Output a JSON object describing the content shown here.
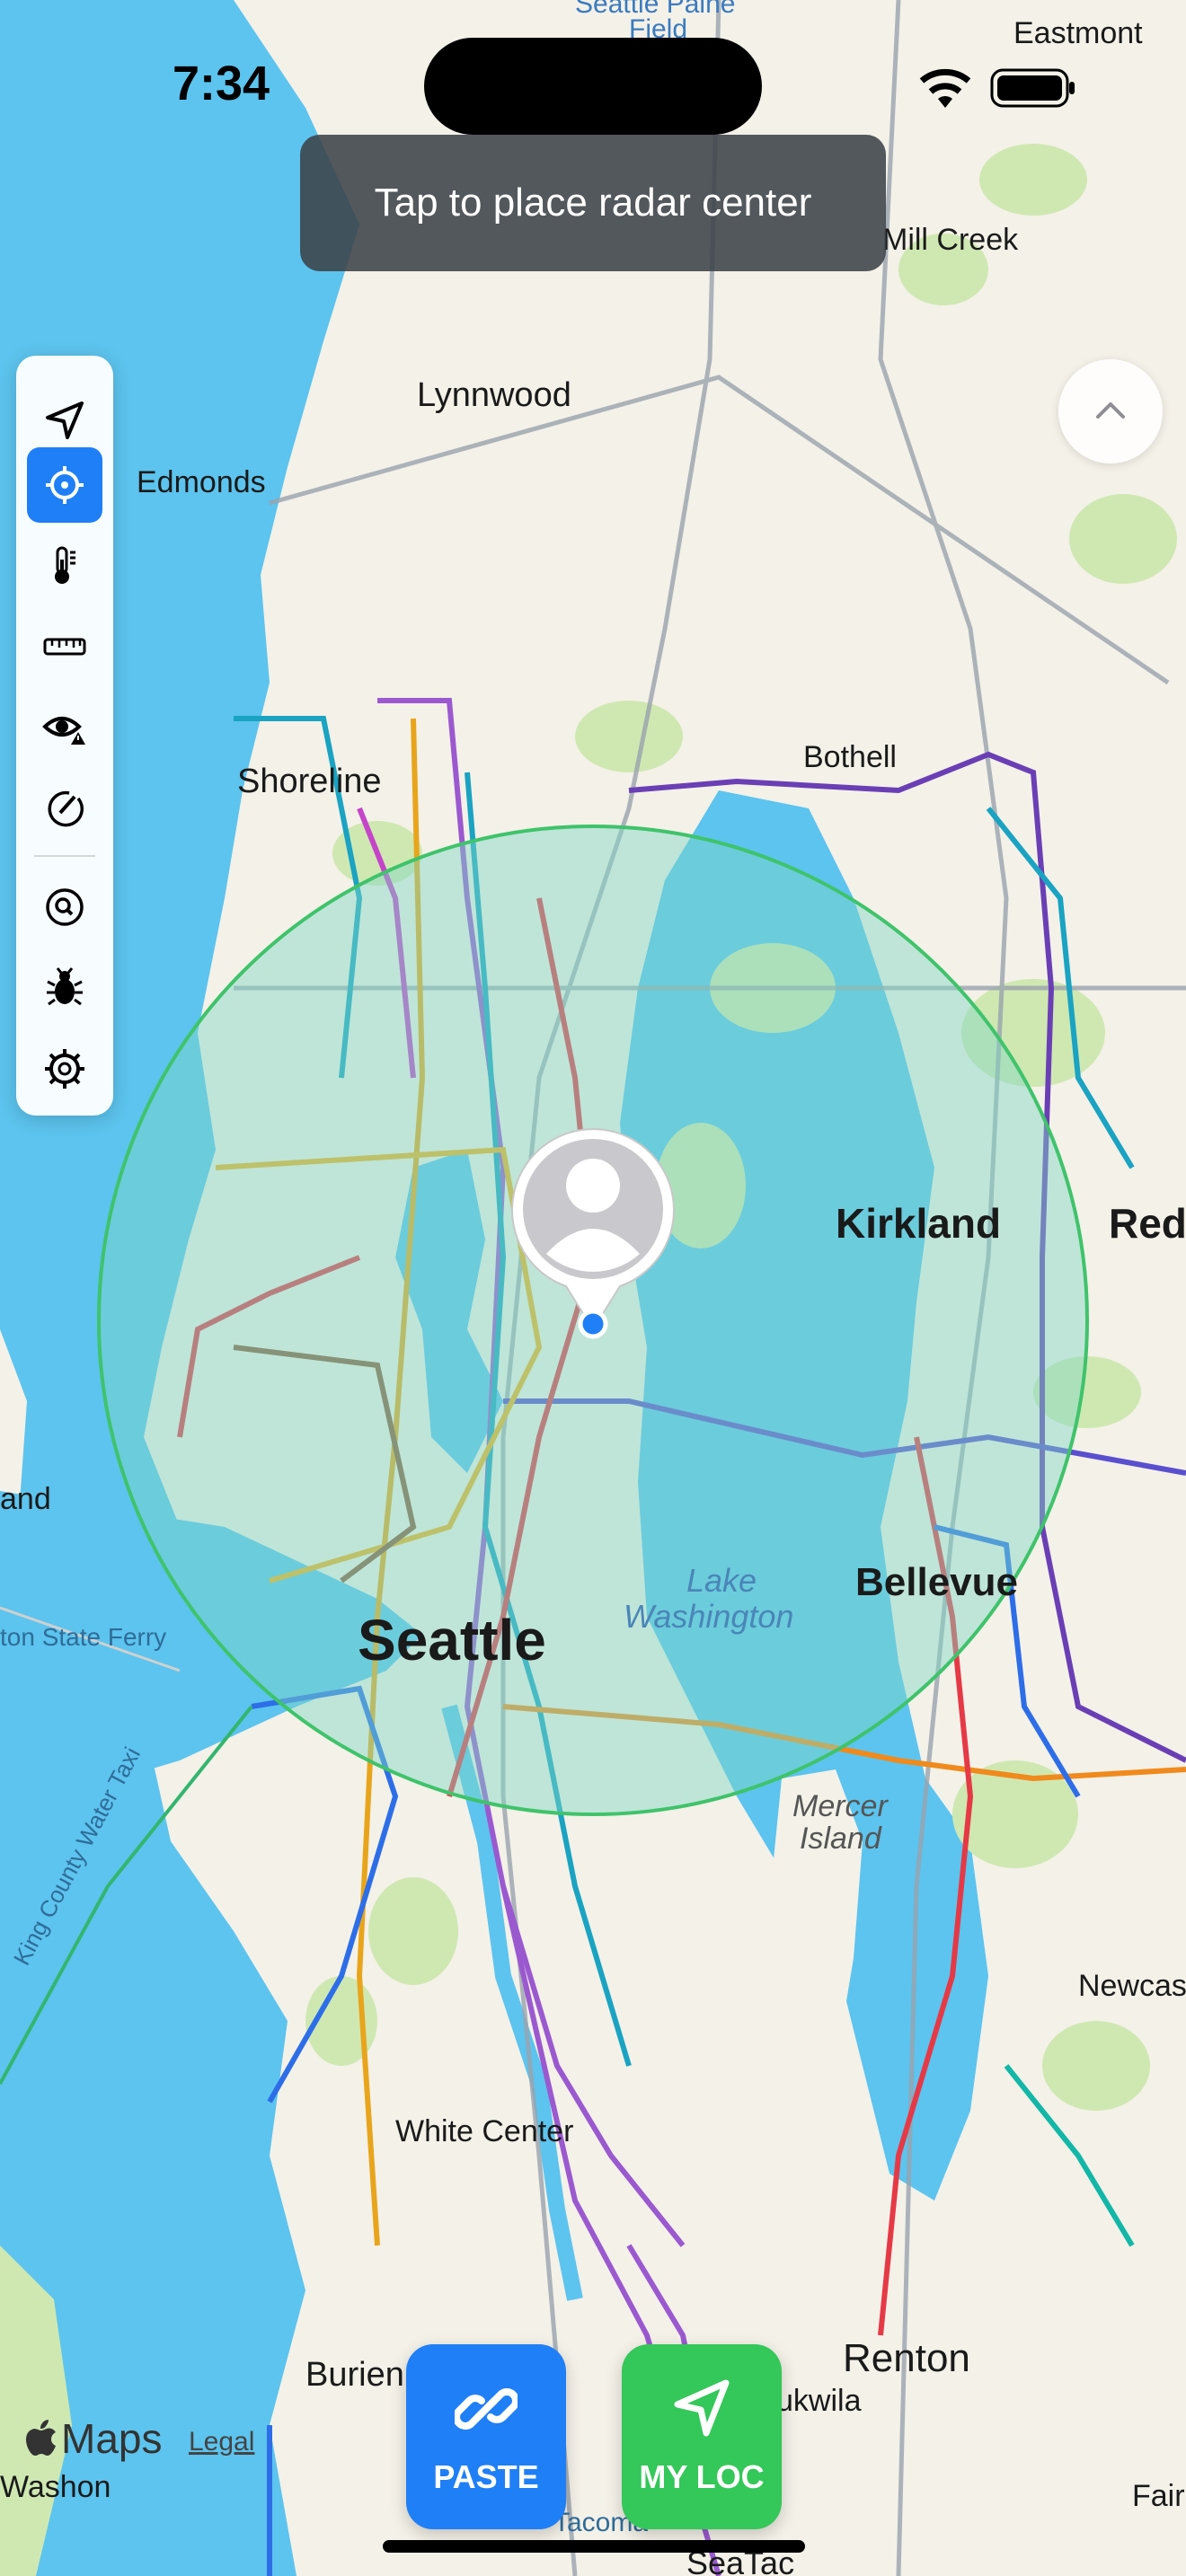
{
  "status_bar": {
    "time": "7:34"
  },
  "toast": {
    "text": "Tap to place radar center"
  },
  "toolbar": {
    "items": [
      {
        "icon": "navigation-arrow-icon",
        "active": false
      },
      {
        "icon": "crosshair-icon",
        "active": true
      },
      {
        "icon": "thermometer-icon",
        "active": false
      },
      {
        "icon": "ruler-icon",
        "active": false
      },
      {
        "icon": "eye-warning-icon",
        "active": false
      },
      {
        "icon": "compass-icon",
        "active": false
      },
      {
        "icon": "search-zoom-icon",
        "active": false
      },
      {
        "icon": "bug-icon",
        "active": false
      },
      {
        "icon": "gear-icon",
        "active": false
      }
    ]
  },
  "map": {
    "labels": {
      "seattle_paine": "Seattle Paine",
      "field": "Field",
      "eastmont": "Eastmont",
      "mill_creek": "Mill Creek",
      "lynnwood": "Lynnwood",
      "edmonds": "Edmonds",
      "shoreline": "Shoreline",
      "bothell": "Bothell",
      "kirkland": "Kirkland",
      "red": "Red",
      "and": "and",
      "lake": "Lake",
      "washington": "Washington",
      "bellevue": "Bellevue",
      "ferry": "ton State Ferry",
      "seattle": "Seattle",
      "water_taxi": "King County Water Taxi",
      "mercer": "Mercer",
      "island": "Island",
      "newcas": "Newcas",
      "white_center": "White Center",
      "burien": "Burien",
      "renton": "Renton",
      "ukwila": "ukwila",
      "washon": "Washon",
      "tacoma": "Tacoma",
      "seatac": "SeaTac",
      "fair": "Fair"
    },
    "colors": {
      "water": "#5cc4ee",
      "land": "#f4f1e8",
      "park": "#cfe8b2",
      "radar_fill": "#7fd6c6",
      "radar_stroke": "#3fc36b"
    }
  },
  "attribution": {
    "maps_label": "Maps",
    "legal_label": "Legal"
  },
  "actions": {
    "paste_label": "PASTE",
    "myloc_label": "MY LOC"
  }
}
